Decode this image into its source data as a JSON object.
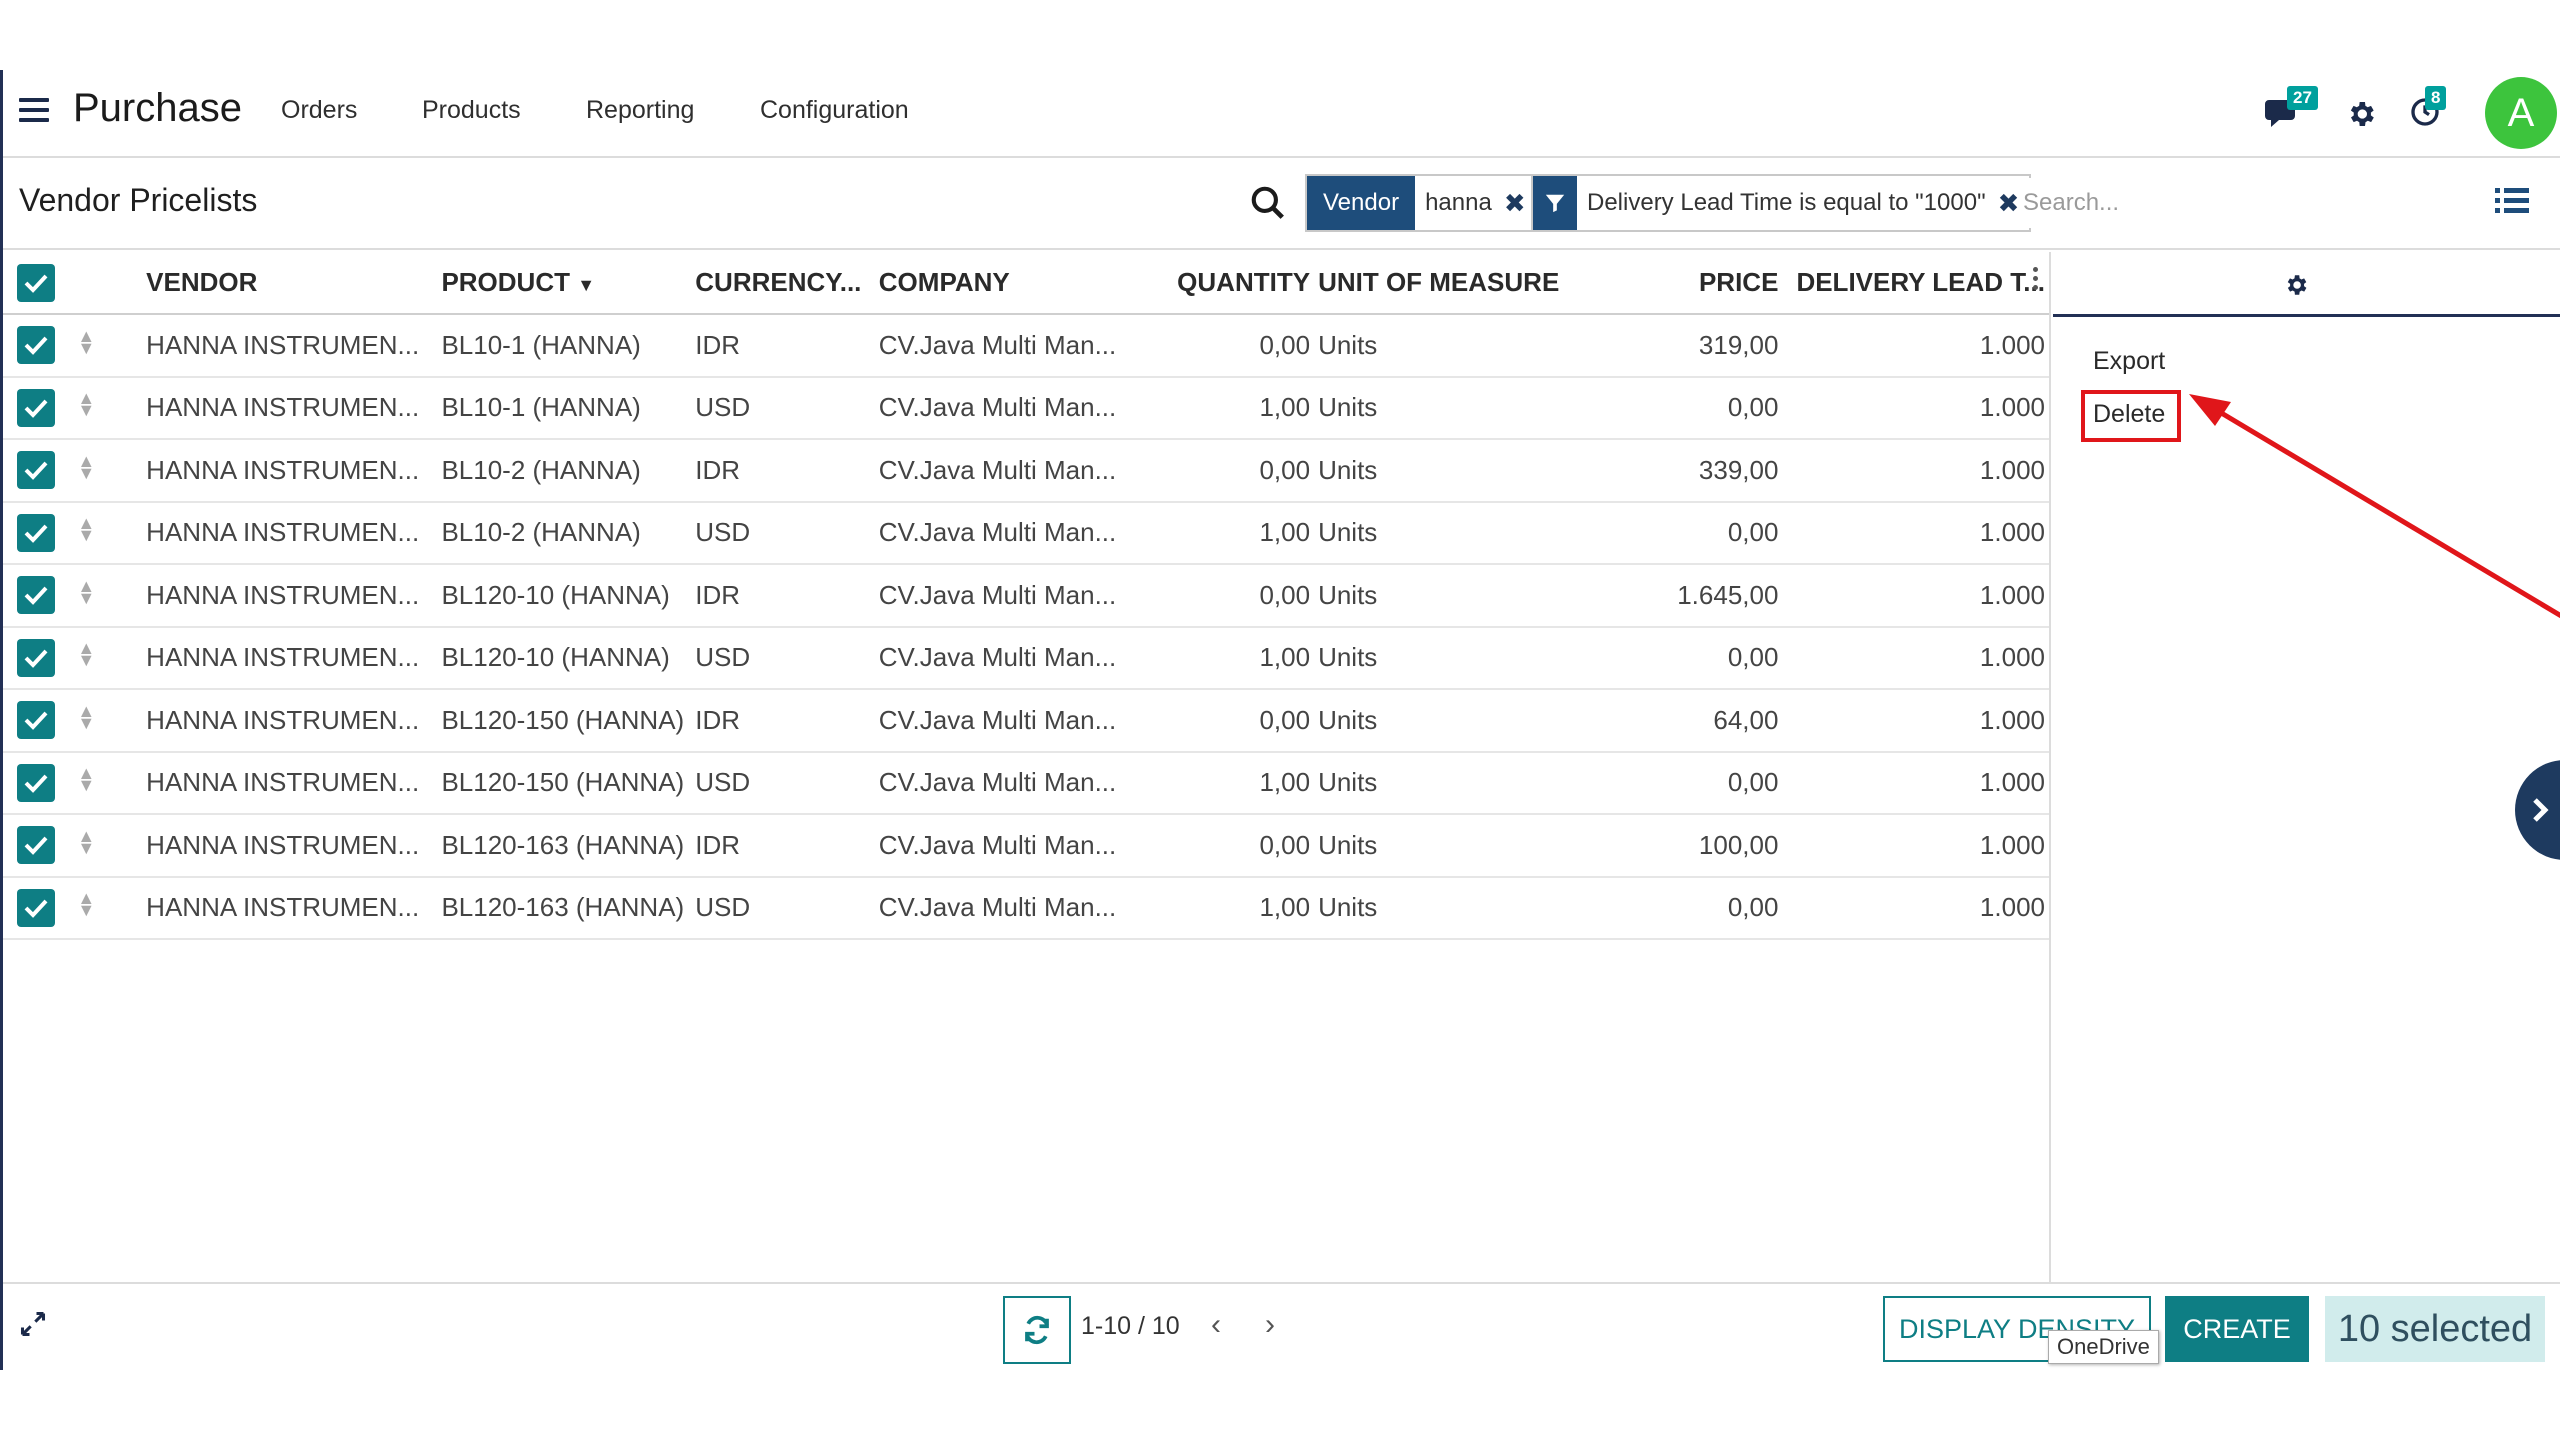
{
  "navbar": {
    "app_title": "Purchase",
    "menu": [
      "Orders",
      "Products",
      "Reporting",
      "Configuration"
    ],
    "messages_count": "27",
    "activities_count": "8",
    "avatar_letter": "A"
  },
  "control": {
    "breadcrumb": "Vendor Pricelists",
    "facets": [
      {
        "category": "Vendor",
        "value": "hanna"
      },
      {
        "category": "filter-icon",
        "value": "Delivery Lead Time is equal to \"1000\""
      }
    ],
    "search_placeholder": "Search..."
  },
  "table": {
    "columns": [
      "VENDOR",
      "PRODUCT",
      "CURRENCY...",
      "COMPANY",
      "QUANTITY",
      "UNIT OF MEASURE",
      "PRICE",
      "DELIVERY LEAD T..."
    ],
    "sort_column": "PRODUCT",
    "rows": [
      {
        "vendor": "HANNA INSTRUMEN...",
        "product": "BL10-1 (HANNA)",
        "currency": "IDR",
        "company": "CV.Java Multi Man...",
        "quantity": "0,00",
        "uom": "Units",
        "price": "319,00",
        "lead": "1.000"
      },
      {
        "vendor": "HANNA INSTRUMEN...",
        "product": "BL10-1 (HANNA)",
        "currency": "USD",
        "company": "CV.Java Multi Man...",
        "quantity": "1,00",
        "uom": "Units",
        "price": "0,00",
        "lead": "1.000"
      },
      {
        "vendor": "HANNA INSTRUMEN...",
        "product": "BL10-2 (HANNA)",
        "currency": "IDR",
        "company": "CV.Java Multi Man...",
        "quantity": "0,00",
        "uom": "Units",
        "price": "339,00",
        "lead": "1.000"
      },
      {
        "vendor": "HANNA INSTRUMEN...",
        "product": "BL10-2 (HANNA)",
        "currency": "USD",
        "company": "CV.Java Multi Man...",
        "quantity": "1,00",
        "uom": "Units",
        "price": "0,00",
        "lead": "1.000"
      },
      {
        "vendor": "HANNA INSTRUMEN...",
        "product": "BL120-10 (HANNA)",
        "currency": "IDR",
        "company": "CV.Java Multi Man...",
        "quantity": "0,00",
        "uom": "Units",
        "price": "1.645,00",
        "lead": "1.000"
      },
      {
        "vendor": "HANNA INSTRUMEN...",
        "product": "BL120-10 (HANNA)",
        "currency": "USD",
        "company": "CV.Java Multi Man...",
        "quantity": "1,00",
        "uom": "Units",
        "price": "0,00",
        "lead": "1.000"
      },
      {
        "vendor": "HANNA INSTRUMEN...",
        "product": "BL120-150 (HANNA)",
        "currency": "IDR",
        "company": "CV.Java Multi Man...",
        "quantity": "0,00",
        "uom": "Units",
        "price": "64,00",
        "lead": "1.000"
      },
      {
        "vendor": "HANNA INSTRUMEN...",
        "product": "BL120-150 (HANNA)",
        "currency": "USD",
        "company": "CV.Java Multi Man...",
        "quantity": "1,00",
        "uom": "Units",
        "price": "0,00",
        "lead": "1.000"
      },
      {
        "vendor": "HANNA INSTRUMEN...",
        "product": "BL120-163 (HANNA)",
        "currency": "IDR",
        "company": "CV.Java Multi Man...",
        "quantity": "0,00",
        "uom": "Units",
        "price": "100,00",
        "lead": "1.000"
      },
      {
        "vendor": "HANNA INSTRUMEN...",
        "product": "BL120-163 (HANNA)",
        "currency": "USD",
        "company": "CV.Java Multi Man...",
        "quantity": "1,00",
        "uom": "Units",
        "price": "0,00",
        "lead": "1.000"
      }
    ]
  },
  "side_panel": {
    "actions": [
      "Export",
      "Delete"
    ],
    "highlighted_action": "Delete",
    "highlight_color": "#e0161a"
  },
  "footer": {
    "pager": "1-10 / 10",
    "display_density_label": "DISPLAY DENSITY",
    "create_label": "CREATE",
    "selected_label": "10 selected",
    "tooltip": "OneDrive"
  },
  "colors": {
    "accent": "#0e7e84",
    "navy": "#1e4d7b",
    "avatar": "#3dc43d"
  }
}
